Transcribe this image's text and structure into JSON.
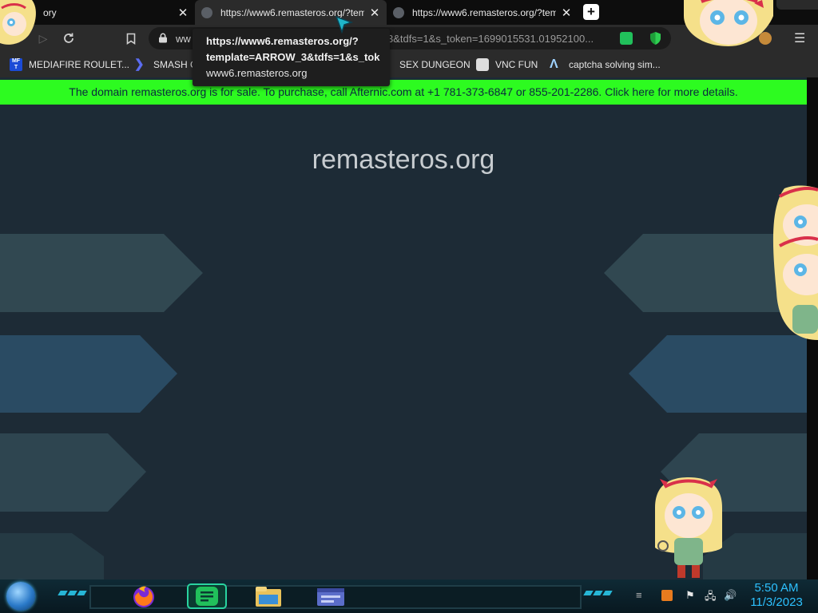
{
  "tabs": [
    {
      "title": "ory",
      "active": false
    },
    {
      "title": "https://www6.remasteros.org/?tem",
      "active": true
    },
    {
      "title": "https://www6.remasteros.org/?tem",
      "active": false
    }
  ],
  "toolbar": {
    "url_visible_prefix": "ww",
    "url_visible_suffix": "3&tdfs=1&s_token=1699015531.01952100..."
  },
  "tooltip": {
    "line1": "https://www6.remasteros.org/?",
    "line2": "template=ARROW_3&tdfs=1&s_tok",
    "line3": "www6.remasteros.org"
  },
  "bookmarks": [
    {
      "label": "MEDIAFIRE ROULET...",
      "icon": "mediafire-icon"
    },
    {
      "label": "SMASH G",
      "icon": "smash-icon"
    },
    {
      "label": "SEX DUNGEON",
      "icon": "dungeon-icon"
    },
    {
      "label": "VNC FUN",
      "icon": "vnc-icon"
    },
    {
      "label": "captcha solving sim...",
      "icon": "captcha-icon"
    }
  ],
  "page": {
    "banner": "The domain remasteros.org is for sale. To purchase, call Afternic.com at +1 781-373-6847 or 855-201-2286. Click here for more details.",
    "domain": "remasteros.org"
  },
  "taskbar": {
    "time": "5:50 AM",
    "date": "11/3/2023",
    "apps": [
      "firefox-icon",
      "notes-app-icon",
      "file-explorer-icon",
      "window-app-icon"
    ]
  },
  "colors": {
    "banner_bg": "#2dfb20",
    "page_bg": "#1d2b36",
    "clock": "#2dc1ff"
  }
}
